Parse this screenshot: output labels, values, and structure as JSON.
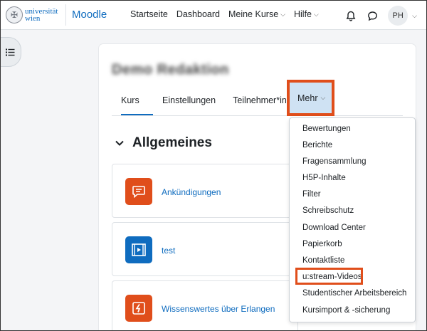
{
  "navbar": {
    "logo_line1": "universität",
    "logo_line2": "wien",
    "brand": "Moodle",
    "items": [
      {
        "label": "Startseite",
        "has_chevron": false
      },
      {
        "label": "Dashboard",
        "has_chevron": false
      },
      {
        "label": "Meine Kurse",
        "has_chevron": true
      },
      {
        "label": "Hilfe",
        "has_chevron": true
      }
    ],
    "avatar_initials": "PH",
    "icons": [
      "bell-icon",
      "chat-icon",
      "chevron-down-icon"
    ]
  },
  "course": {
    "title": "Demo Redaktion",
    "tabs": [
      "Kurs",
      "Einstellungen",
      "Teilnehmer*innen"
    ],
    "more_label": "Mehr",
    "section": "Allgemeines"
  },
  "activities": [
    {
      "label": "Ankündigungen",
      "icon": "forum-icon",
      "color": "#e04e1b"
    },
    {
      "label": "test",
      "icon": "video-icon",
      "color": "#0f6cbf"
    },
    {
      "label": "Wissenswertes über Erlangen",
      "icon": "h5p-icon",
      "color": "#e04e1b"
    }
  ],
  "more_menu": {
    "items": [
      "Bewertungen",
      "Berichte",
      "Fragensammlung",
      "H5P-Inhalte",
      "Filter",
      "Schreibschutz",
      "Download Center",
      "Papierkorb",
      "Kontaktliste",
      "u:stream-Videos",
      "Studentischer Arbeitsbereich",
      "Kursimport & -sicherung"
    ],
    "highlighted": "u:stream-Videos"
  },
  "colors": {
    "accent": "#0f6cbf",
    "highlight_border": "#e04e1b",
    "active_tab_bg": "#cfe2f3"
  }
}
